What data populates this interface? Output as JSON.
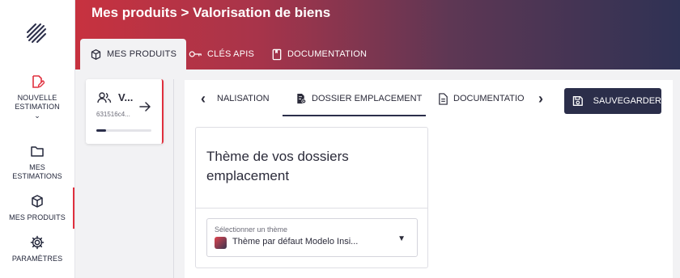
{
  "header": {
    "title": "Mes produits > Valorisation de biens",
    "tabs": [
      {
        "label": "MES PRODUITS",
        "icon": "box-icon",
        "active": true
      },
      {
        "label": "CLÉS APIS",
        "icon": "key-icon",
        "active": false
      },
      {
        "label": "DOCUMENTATION",
        "icon": "book-icon",
        "active": false
      }
    ]
  },
  "sidebar": {
    "items": [
      {
        "label_line1": "NOUVELLE",
        "label_line2": "ESTIMATION",
        "icon": "edit-doc-icon",
        "accent": "#e0303e"
      },
      {
        "label_line1": "MES",
        "label_line2": "ESTIMATIONS",
        "icon": "folder-icon"
      },
      {
        "label_line1": "MES PRODUITS",
        "icon": "box-icon",
        "active": true
      },
      {
        "label_line1": "PARAMÈTRES",
        "icon": "gear-icon"
      }
    ],
    "chevron": "⌄"
  },
  "product_card": {
    "name": "V...",
    "id": "631516c4...",
    "progress": 0.18
  },
  "panel": {
    "tabs": [
      {
        "label": "NALISATION",
        "icon": null
      },
      {
        "label": "DOSSIER EMPLACEMENT",
        "icon": "doc-pin-icon",
        "active": true
      },
      {
        "label": "DOCUMENTATIO",
        "icon": "doc-icon"
      }
    ],
    "save_label": "SAUVEGARDER",
    "theme_card": {
      "title": "Thème de vos dossiers emplacement",
      "select_label": "Sélectionner un thème",
      "select_value": "Thème par défaut Modelo Insi..."
    }
  },
  "colors": {
    "accent": "#e0303e",
    "navy": "#2b2e4a",
    "swatch_start": "#e0444f",
    "swatch_end": "#3a3550"
  }
}
